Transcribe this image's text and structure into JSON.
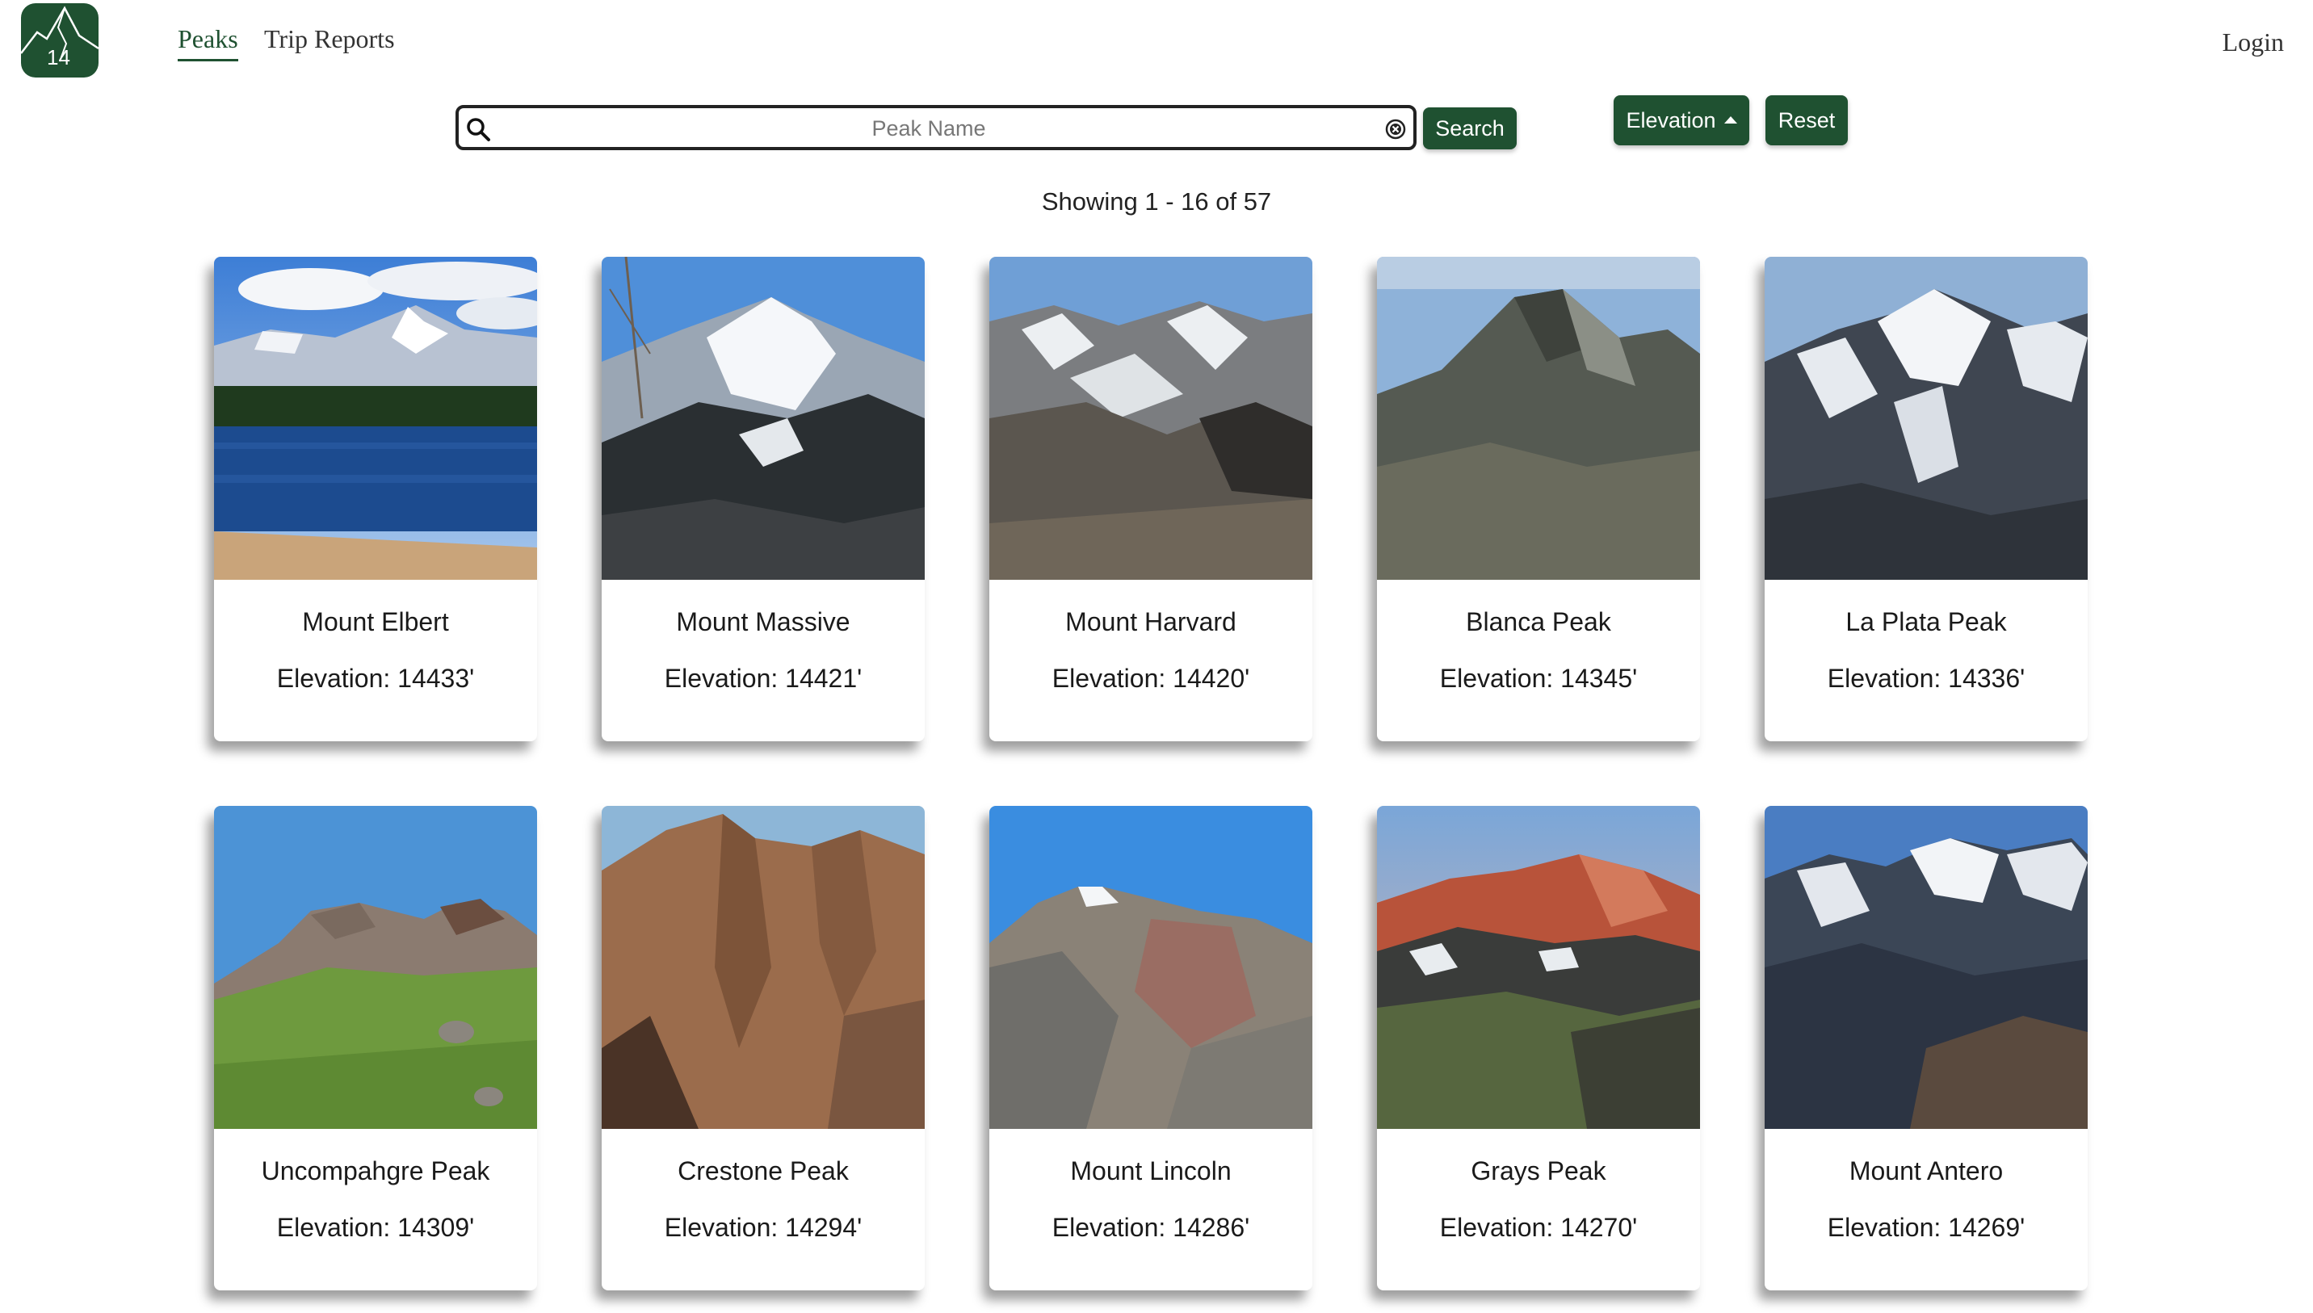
{
  "logo": {
    "text": "14"
  },
  "nav": {
    "peaks": "Peaks",
    "trip_reports": "Trip Reports",
    "login": "Login"
  },
  "search": {
    "placeholder": "Peak Name",
    "value": "",
    "button": "Search"
  },
  "sort": {
    "label": "Elevation",
    "direction": "ascending"
  },
  "reset": {
    "label": "Reset"
  },
  "showing": "Showing 1 - 16 of 57",
  "colors": {
    "brand": "#1f5131"
  },
  "peaks": [
    {
      "name": "Mount Elbert",
      "elevation": "Elevation: 14433'"
    },
    {
      "name": "Mount Massive",
      "elevation": "Elevation: 14421'"
    },
    {
      "name": "Mount Harvard",
      "elevation": "Elevation: 14420'"
    },
    {
      "name": "Blanca Peak",
      "elevation": "Elevation: 14345'"
    },
    {
      "name": "La Plata Peak",
      "elevation": "Elevation: 14336'"
    },
    {
      "name": "Uncompahgre Peak",
      "elevation": "Elevation: 14309'"
    },
    {
      "name": "Crestone Peak",
      "elevation": "Elevation: 14294'"
    },
    {
      "name": "Mount Lincoln",
      "elevation": "Elevation: 14286'"
    },
    {
      "name": "Grays Peak",
      "elevation": "Elevation: 14270'"
    },
    {
      "name": "Mount Antero",
      "elevation": "Elevation: 14269'"
    }
  ]
}
